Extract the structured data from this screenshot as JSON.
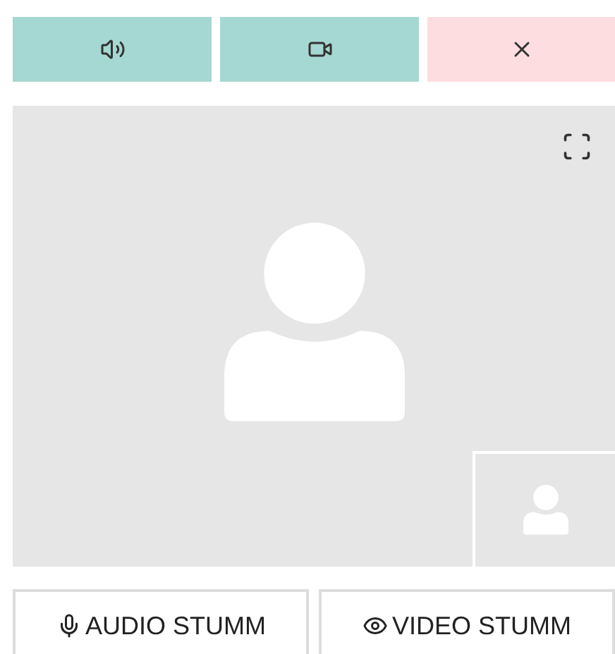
{
  "call_controls": [
    {
      "kind": "sound"
    },
    {
      "kind": "camera"
    },
    {
      "kind": "hangup"
    }
  ],
  "video": {
    "remote": {
      "kind": "avatar"
    },
    "local": {
      "kind": "avatar"
    }
  },
  "mute_buttons": [
    {
      "kind": "mic",
      "label": "AUDIO STUMM"
    },
    {
      "kind": "eye",
      "label": "VIDEO STUMM"
    }
  ]
}
